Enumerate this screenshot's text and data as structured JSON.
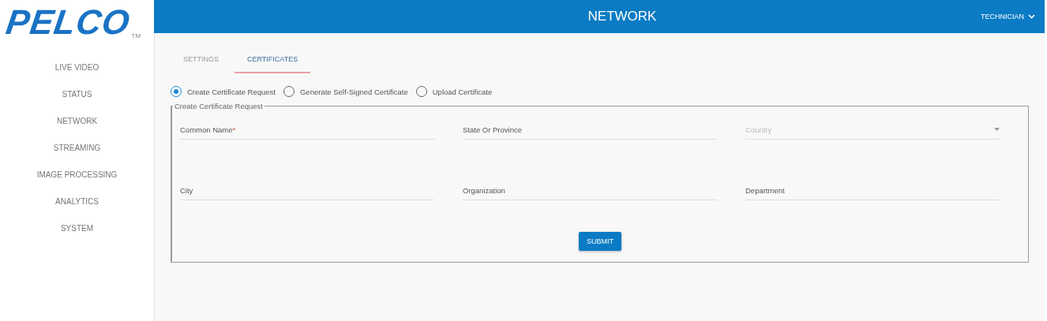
{
  "logo": {
    "text": "PELCO",
    "trademark": "TM"
  },
  "sidebar": {
    "items": [
      {
        "label": "LIVE VIDEO"
      },
      {
        "label": "STATUS"
      },
      {
        "label": "NETWORK"
      },
      {
        "label": "STREAMING"
      },
      {
        "label": "IMAGE PROCESSING"
      },
      {
        "label": "ANALYTICS"
      },
      {
        "label": "SYSTEM"
      }
    ]
  },
  "header": {
    "title": "NETWORK",
    "user": "TECHNICIAN"
  },
  "tabs": [
    {
      "label": "SETTINGS",
      "selected": false
    },
    {
      "label": "CERTIFICATES",
      "selected": true
    }
  ],
  "options": [
    {
      "label": "Create Certificate Request",
      "selected": true
    },
    {
      "label": "Generate Self-Signed Certificate",
      "selected": false
    },
    {
      "label": "Upload Certificate",
      "selected": false
    }
  ],
  "form": {
    "legend": "Create Certificate Request",
    "fields": [
      {
        "kind": "text",
        "label": "Common Name",
        "required_mark": "*"
      },
      {
        "kind": "text",
        "label": "State Or Province"
      },
      {
        "kind": "select",
        "label": "Country",
        "disabled": true
      },
      {
        "kind": "text",
        "label": "City"
      },
      {
        "kind": "text",
        "label": "Organization"
      },
      {
        "kind": "text",
        "label": "Department"
      }
    ],
    "submit": "SUBMIT"
  }
}
